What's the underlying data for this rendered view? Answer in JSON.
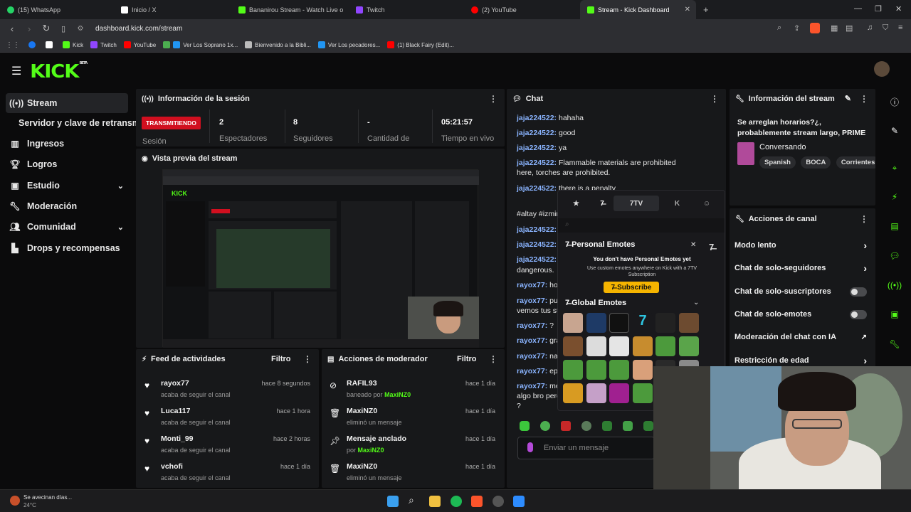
{
  "browser": {
    "tabs": [
      {
        "title": "(15) WhatsApp",
        "color": "#25d366"
      },
      {
        "title": "Inicio / X",
        "color": "#ffffff"
      },
      {
        "title": "Bananirou Stream - Watch Live o",
        "color": "#53fc18"
      },
      {
        "title": "Twitch",
        "color": "#9146ff"
      },
      {
        "title": "(2) YouTube",
        "color": "#ff0000"
      },
      {
        "title": "Stream - Kick Dashboard",
        "color": "#53fc18"
      }
    ],
    "url": "dashboard.kick.com/stream",
    "bookmarks": [
      "Kick",
      "Twitch",
      "YouTube",
      "Ver Los Soprano 1x...",
      "Bienvenido a la Bibli...",
      "Ver Los pecadores...",
      "(1) Black Fairy (Edit)..."
    ]
  },
  "app": {
    "logo": "KICK",
    "logo_beta": "BETA",
    "accent": "#53fc18"
  },
  "sidebar": {
    "items": [
      {
        "label": "Stream",
        "icon": "broadcast-icon"
      },
      {
        "label": "Servidor y clave de retransm",
        "icon": ""
      },
      {
        "label": "Ingresos",
        "icon": "chart-icon"
      },
      {
        "label": "Logros",
        "icon": "trophy-icon"
      },
      {
        "label": "Estudio",
        "icon": "studio-icon"
      },
      {
        "label": "Moderación",
        "icon": "wrench-icon"
      },
      {
        "label": "Comunidad",
        "icon": "users-icon"
      },
      {
        "label": "Drops y recompensas",
        "icon": "drops-icon"
      }
    ]
  },
  "session": {
    "title": "Información de la sesión",
    "live_label": "TRANSMITIENDO",
    "live_sub": "Sesión",
    "stats": [
      {
        "value": "2",
        "label": "Espectadores"
      },
      {
        "value": "8",
        "label": "Seguidores"
      },
      {
        "value": "-",
        "label": "Cantidad de"
      },
      {
        "value": "05:21:57",
        "label": "Tiempo en vivo"
      }
    ]
  },
  "preview": {
    "title": "Vista previa del stream"
  },
  "feed": {
    "title": "Feed de actividades",
    "filter": "Filtro",
    "items": [
      {
        "name": "rayox77",
        "sub": "acaba de seguir el canal",
        "time": "hace 8 segundos"
      },
      {
        "name": "Luca117",
        "sub": "acaba de seguir el canal",
        "time": "hace 1 hora"
      },
      {
        "name": "Monti_99",
        "sub": "acaba de seguir el canal",
        "time": "hace 2 horas"
      },
      {
        "name": "vchofi",
        "sub": "acaba de seguir el canal",
        "time": "hace 1 día"
      }
    ]
  },
  "mod": {
    "title": "Acciones de moderador",
    "filter": "Filtro",
    "items": [
      {
        "name": "RAFIL93",
        "sub": "baneado por",
        "by": "MaxiNZ0",
        "time": "hace 1 día",
        "icon": "ban-icon"
      },
      {
        "name": "MaxiNZ0",
        "sub": "eliminó un mensaje",
        "by": "",
        "time": "hace 1 día",
        "icon": "trash-icon"
      },
      {
        "name": "Mensaje anclado",
        "sub": "por",
        "by": "MaxiNZ0",
        "time": "hace 1 día",
        "icon": "pin-icon"
      },
      {
        "name": "MaxiNZ0",
        "sub": "eliminó un mensaje",
        "by": "",
        "time": "hace 1 día",
        "icon": "trash-icon"
      }
    ]
  },
  "chat": {
    "title": "Chat",
    "messages": [
      {
        "user": "jaja224522:",
        "text": " hahaha"
      },
      {
        "user": "jaja224522:",
        "text": " good"
      },
      {
        "user": "jaja224522:",
        "text": " ya"
      },
      {
        "user": "jaja224522:",
        "text": " Flammable materials are prohibited here, torches are prohibited."
      },
      {
        "user": "jaja224522:",
        "text": " there is a penalty"
      },
      {
        "user": "jaja224522:",
        "text": ""
      },
      {
        "user": "jaja224522:",
        "text": ""
      },
      {
        "user": "jaja224522:",
        "text": ""
      },
      {
        "user": "rayox77:",
        "text": " hol"
      },
      {
        "user": "rayox77:",
        "text": " pue"
      },
      {
        "user": "rayox77:",
        "text": " ?"
      },
      {
        "user": "rayox77:",
        "text": " gra"
      },
      {
        "user": "rayox77:",
        "text": " nah"
      },
      {
        "user": "rayox77:",
        "text": " epa"
      },
      {
        "user": "rayox77:",
        "text": " me"
      }
    ],
    "extra": [
      "#altay #izmir",
      "dangerous.",
      "vemos tus st",
      "algo bro perc",
      "?"
    ],
    "input_placeholder": "Enviar un mensaje"
  },
  "emotes": {
    "tab_7tv": "7TV",
    "personal_title": "Personal Emotes",
    "personal_msg": "You don't have Personal Emotes yet",
    "personal_sub": "Use custom emotes anywhere on Kick with a 7TV Subscription",
    "subscribe": "Subscribe",
    "global_title": "Global Emotes"
  },
  "stream_info": {
    "title": "Información del stream",
    "stream_title": "Se arreglan horarios?¿, probablemente stream largo, PRIME",
    "category": "Conversando",
    "tags": [
      "Spanish",
      "BOCA",
      "Corrientes"
    ]
  },
  "channel_actions": {
    "title": "Acciones de canal",
    "items": [
      {
        "label": "Modo lento",
        "type": "arrow"
      },
      {
        "label": "Chat de solo-seguidores",
        "type": "arrow"
      },
      {
        "label": "Chat de solo-suscriptores",
        "type": "toggle"
      },
      {
        "label": "Chat de solo-emotes",
        "type": "toggle"
      },
      {
        "label": "Moderación del chat con IA",
        "type": "external"
      },
      {
        "label": "Restricción de edad",
        "type": "arrow"
      }
    ]
  },
  "taskbar": {
    "weather_title": "Se avecinan días...",
    "weather_temp": "24°C"
  }
}
